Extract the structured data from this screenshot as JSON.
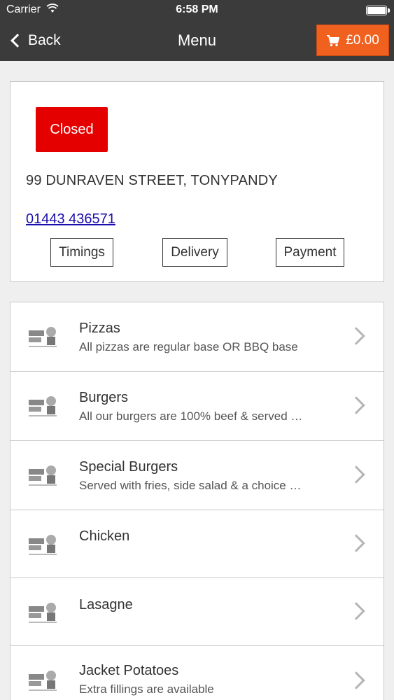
{
  "status_bar": {
    "carrier": "Carrier",
    "time": "6:58 PM"
  },
  "nav": {
    "back_label": "Back",
    "title": "Menu",
    "cart_total": "£0.00"
  },
  "store": {
    "status": "Closed",
    "address": "99 DUNRAVEN STREET, TONYPANDY",
    "phone": "01443 436571",
    "buttons": [
      "Timings",
      "Delivery",
      "Payment"
    ]
  },
  "menu": [
    {
      "title": "Pizzas",
      "desc": "All pizzas are regular base OR BBQ base"
    },
    {
      "title": "Burgers",
      "desc": "All our burgers are 100% beef & served …"
    },
    {
      "title": "Special Burgers",
      "desc": "Served with fries, side salad & a choice …"
    },
    {
      "title": "Chicken",
      "desc": ""
    },
    {
      "title": "Lasagne",
      "desc": ""
    },
    {
      "title": "Jacket Potatoes",
      "desc": "Extra fillings are available"
    }
  ],
  "colors": {
    "nav_bg": "#3b3b3b",
    "cart_accent": "#f0611f",
    "closed_red": "#e50000",
    "link": "#1a0dab"
  },
  "icons": {
    "cart": "cart-icon",
    "wifi": "wifi-icon",
    "back": "chevron-left-icon",
    "row": "chevron-right-icon",
    "logo": "pizza-to-go-logo"
  }
}
